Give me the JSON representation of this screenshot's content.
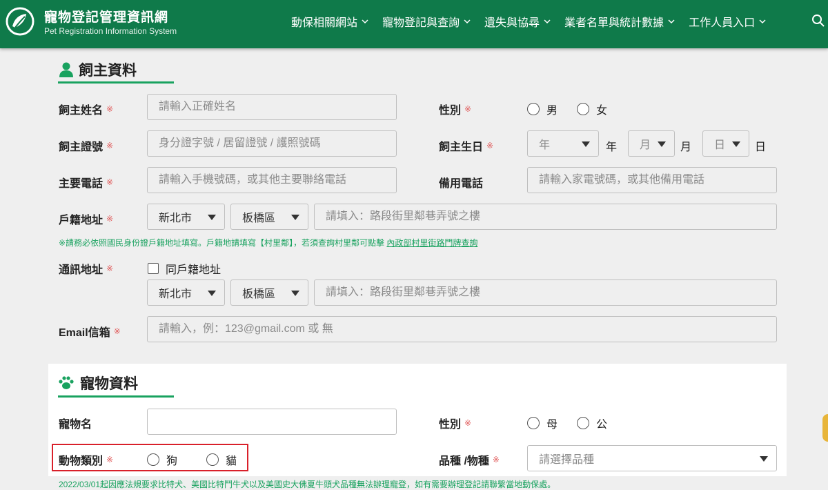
{
  "header": {
    "title": "寵物登記管理資訊網",
    "subtitle": "Pet Registration Information System",
    "nav": [
      {
        "label": "動保相關網站"
      },
      {
        "label": "寵物登記與查詢"
      },
      {
        "label": "遺失與協尋"
      },
      {
        "label": "業者名單與統計數據"
      },
      {
        "label": "工作人員入口"
      }
    ],
    "icons": {
      "logo": "paw-leaf-logo-icon",
      "search": "search-icon",
      "chevron": "chevron-down-icon"
    }
  },
  "owner": {
    "section_title": "飼主資料",
    "required_mark": "※",
    "name": {
      "label": "飼主姓名",
      "placeholder": "請輸入正確姓名"
    },
    "gender": {
      "label": "性別",
      "options": [
        "男",
        "女"
      ]
    },
    "id": {
      "label": "飼主證號",
      "placeholder": "身分證字號 / 居留證號 / 護照號碼"
    },
    "birthday": {
      "label": "飼主生日",
      "year_placeholder": "年",
      "year_unit": "年",
      "month_placeholder": "月",
      "month_unit": "月",
      "day_placeholder": "日",
      "day_unit": "日"
    },
    "phone": {
      "label": "主要電話",
      "placeholder": "請輸入手機號碼，或其他主要聯絡電話"
    },
    "alt_phone": {
      "label": "備用電話",
      "placeholder": "請輸入家電號碼，或其他備用電話"
    },
    "household_address": {
      "label": "戶籍地址",
      "city": "新北市",
      "district": "板橋區",
      "placeholder": "請填入：路段街里鄰巷弄號之樓"
    },
    "address_note": "※請務必依照國民身份證戶籍地址填寫。戶籍地請填寫【村里鄰】，若須查詢村里鄰可點擊",
    "address_note_link": "內政部村里街路門牌查詢",
    "mailing_address": {
      "label": "通訊地址",
      "same_as": "同戶籍地址",
      "city": "新北市",
      "district": "板橋區",
      "placeholder": "請填入：路段街里鄰巷弄號之樓"
    },
    "email": {
      "label": "Email信箱",
      "placeholder": "請輸入，例：123@gmail.com 或 無"
    }
  },
  "pet": {
    "section_title": "寵物資料",
    "name": {
      "label": "寵物名",
      "value": ""
    },
    "gender": {
      "label": "性別",
      "options": [
        "母",
        "公"
      ]
    },
    "species": {
      "label": "動物類別",
      "options": [
        "狗",
        "貓"
      ]
    },
    "breed": {
      "label": "品種 /物種",
      "placeholder": "請選擇品種"
    },
    "note": "2022/03/01起因應法規要求比特犬、美國比特鬥牛犬以及美國史大佛夏牛頭犬品種無法辦理寵登，如有需要辦理登記請聯繫當地動保處。"
  },
  "colors": {
    "brand_green": "#0f7a4a",
    "accent_green": "#19a25f",
    "required_red": "#e05a5a",
    "highlight_red": "#d9202a"
  }
}
